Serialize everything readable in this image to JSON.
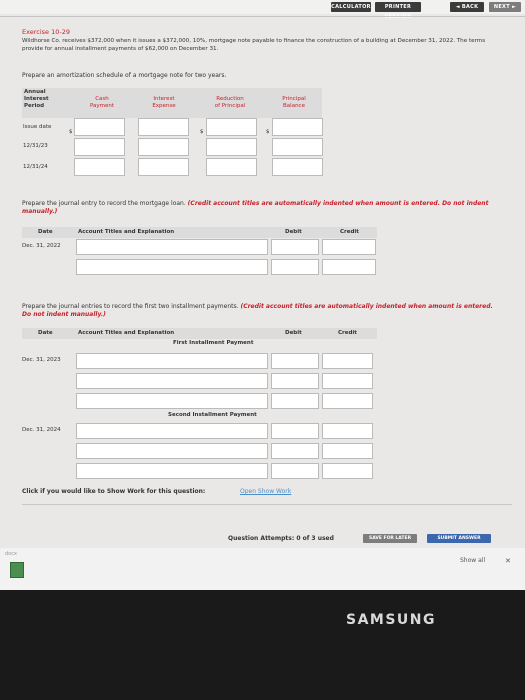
{
  "toolbar": {
    "calculator_label": "CALCULATOR",
    "printer_version_label": "PRINTER VERSION",
    "back_label": "◄ BACK",
    "next_label": "NEXT ►"
  },
  "exercise": {
    "title": "Exercise 10-29",
    "description": "Wildhorse Co. receives $372,000 when it issues a $372,000, 10%, mortgage note payable to finance the construction of a building at December 31, 2022. The terms provide for annual installment payments of $62,000 on December 31."
  },
  "amortization": {
    "instruction": "Prepare an amortization schedule of a mortgage note for two years.",
    "headers": [
      "Annual\nInterest\nPeriod",
      "Cash\nPayment",
      "Interest\nExpense",
      "Reduction\nof Principal",
      "Principal\nBalance"
    ],
    "rows": [
      "Issue date",
      "12/31/23",
      "12/31/24"
    ],
    "currency_symbol": "$"
  },
  "journal1": {
    "instruction": "Prepare the journal entry to record the mortgage loan.",
    "note": "(Credit account titles are automatically indented when amount is entered. Do not indent manually.)",
    "headers": {
      "date": "Date",
      "account": "Account Titles and Explanation",
      "debit": "Debit",
      "credit": "Credit"
    },
    "date": "Dec. 31, 2022"
  },
  "journal2": {
    "instruction": "Prepare the journal entries to record the first two installment payments.",
    "note": "(Credit account titles are automatically indented when amount is entered. Do not indent manually.)",
    "headers": {
      "date": "Date",
      "account": "Account Titles and Explanation",
      "debit": "Debit",
      "credit": "Credit"
    },
    "first_label": "First Installment Payment",
    "second_label": "Second Installment Payment",
    "date1": "Dec. 31, 2023",
    "date2": "Dec. 31, 2024"
  },
  "show_work": {
    "prompt": "Click if you would like to Show Work for this question:",
    "link": "Open Show Work"
  },
  "footer": {
    "attempts": "Question Attempts: 0 of 3 used",
    "save_label": "SAVE FOR LATER",
    "submit_label": "SUBMIT ANSWER"
  },
  "downloads": {
    "file_label": "docx",
    "show_all": "Show all",
    "close": "✕"
  },
  "brand": "SAMSUNG"
}
